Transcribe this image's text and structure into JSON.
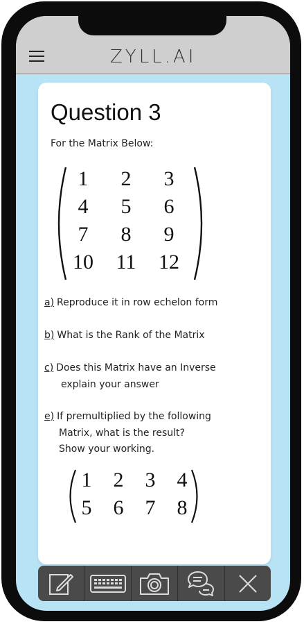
{
  "header": {
    "menu_icon": "hamburger-menu-icon",
    "logo": "ZYLL.AI"
  },
  "question": {
    "title": "Question 3",
    "intro": "For the Matrix Below:",
    "matrix_main": [
      [
        "1",
        "2",
        "3"
      ],
      [
        "4",
        "5",
        "6"
      ],
      [
        "7",
        "8",
        "9"
      ],
      [
        "10",
        "11",
        "12"
      ]
    ],
    "parts": [
      {
        "label": "a)",
        "lines": [
          "Reproduce it in row echelon form"
        ]
      },
      {
        "label": "b)",
        "lines": [
          "What is the Rank of the Matrix"
        ]
      },
      {
        "label": "c)",
        "lines": [
          "Does this Matrix have an Inverse",
          "explain your answer"
        ]
      },
      {
        "label": "e)",
        "lines": [
          "If premultiplied by the following",
          "Matrix, what is the result?",
          "Show your working."
        ]
      }
    ],
    "matrix_second": [
      [
        "1",
        "2",
        "3",
        "4"
      ],
      [
        "5",
        "6",
        "7",
        "8"
      ]
    ]
  },
  "toolbar": {
    "items": [
      {
        "icon": "edit-icon"
      },
      {
        "icon": "keyboard-icon"
      },
      {
        "icon": "camera-icon"
      },
      {
        "icon": "chat-icon"
      },
      {
        "icon": "close-icon"
      }
    ]
  },
  "colors": {
    "screen_bg": "#b7e3f5",
    "header_bg": "#cfcfcf",
    "toolbar_bg": "#4a4a4a",
    "phone_frame": "#0c0c0c"
  }
}
